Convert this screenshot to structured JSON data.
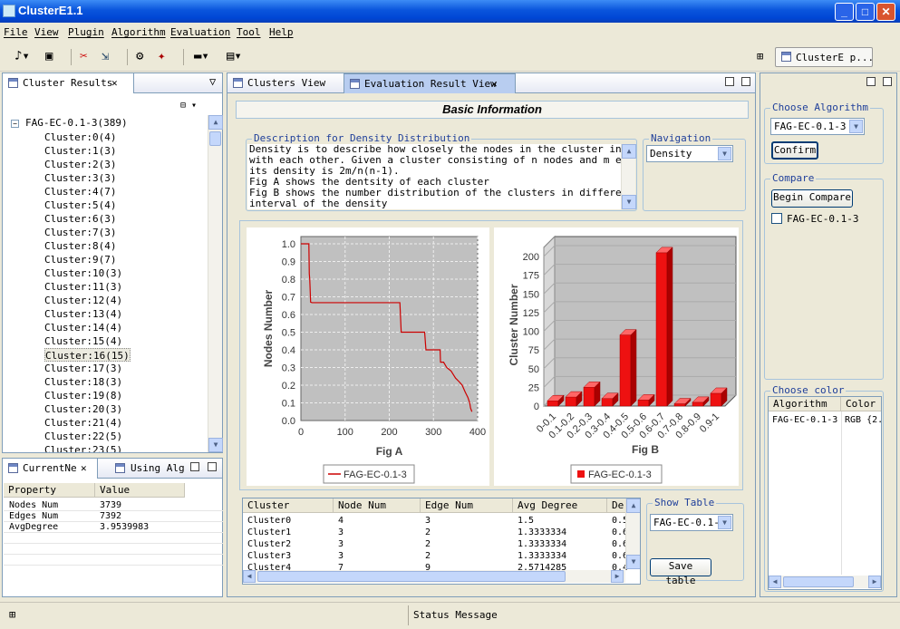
{
  "window": {
    "title": "ClusterE1.1",
    "min": "_",
    "max": "□",
    "close": "✕"
  },
  "menu": [
    "File",
    "View",
    "Plugin",
    "Algorithm",
    "Evaluation",
    "Tool",
    "Help"
  ],
  "toolbar": {
    "perspective_label": "ClusterE p..."
  },
  "cluster_results": {
    "tab_label": "Cluster Results",
    "root": "FAG-EC-0.1-3(389)",
    "items": [
      "Cluster:0(4)",
      "Cluster:1(3)",
      "Cluster:2(3)",
      "Cluster:3(3)",
      "Cluster:4(7)",
      "Cluster:5(4)",
      "Cluster:6(3)",
      "Cluster:7(3)",
      "Cluster:8(4)",
      "Cluster:9(7)",
      "Cluster:10(3)",
      "Cluster:11(3)",
      "Cluster:12(4)",
      "Cluster:13(4)",
      "Cluster:14(4)",
      "Cluster:15(4)",
      "Cluster:16(15)",
      "Cluster:17(3)",
      "Cluster:18(3)",
      "Cluster:19(8)",
      "Cluster:20(3)",
      "Cluster:21(4)",
      "Cluster:22(5)",
      "Cluster:23(5)"
    ],
    "selected_index": 16
  },
  "current_panel": {
    "tab1": "CurrentNe",
    "tab2": "Using Alg",
    "headers": [
      "Property",
      "Value"
    ],
    "rows": [
      [
        "Nodes Num",
        "3739"
      ],
      [
        "Edges Num",
        "7392"
      ],
      [
        "AvgDegree",
        "3.9539983"
      ]
    ]
  },
  "center_tabs": {
    "tab1": "Clusters View",
    "tab2": "Evaluation Result View"
  },
  "basic_info": {
    "title": "Basic Information"
  },
  "description": {
    "legend": "Description for Density Distribution",
    "lines": [
      "Density is to describe how closely the nodes in the cluster interact",
      "with each other. Given a cluster consisting of n nodes and m edges,",
      "its density is 2m/n(n-1).",
      "Fig A shows the dentsity of each cluster",
      "Fig B shows the number distribution of the clusters in different",
      "interval of the density"
    ]
  },
  "navigation": {
    "legend": "Navigation",
    "value": "Density"
  },
  "chart_data": [
    {
      "type": "line",
      "xlabel": "Fig A",
      "ylabel": "Nodes Number",
      "xlim": [
        0,
        400
      ],
      "ylim": [
        0,
        1.0
      ],
      "xticks": [
        "0",
        "100",
        "200",
        "300",
        "400"
      ],
      "yticks": [
        "0.0",
        "0.1",
        "0.2",
        "0.3",
        "0.4",
        "0.5",
        "0.6",
        "0.7",
        "0.8",
        "0.9",
        "1.0"
      ],
      "series": [
        {
          "name": "FAG-EC-0.1-3",
          "color": "#cc0000",
          "x": [
            0,
            18,
            19,
            20,
            22,
            25,
            40,
            100,
            150,
            200,
            224,
            227,
            260,
            262,
            280,
            283,
            305,
            315,
            316,
            323,
            330,
            340,
            345,
            350,
            358,
            365,
            372,
            378,
            382,
            384,
            387
          ],
          "y": [
            1.0,
            1.0,
            0.83,
            0.8,
            0.67,
            0.667,
            0.667,
            0.667,
            0.667,
            0.667,
            0.667,
            0.5,
            0.5,
            0.5,
            0.5,
            0.4,
            0.4,
            0.4,
            0.33,
            0.33,
            0.3,
            0.28,
            0.26,
            0.24,
            0.22,
            0.2,
            0.16,
            0.13,
            0.1,
            0.07,
            0.05
          ]
        }
      ],
      "grid": true,
      "legend": "bottom"
    },
    {
      "type": "bar",
      "xlabel": "Fig B",
      "ylabel": "Cluster Number",
      "ylim": [
        0,
        200
      ],
      "yticks": [
        "0",
        "25",
        "50",
        "75",
        "100",
        "125",
        "150",
        "175",
        "200"
      ],
      "categories": [
        "0-0.1",
        "0.1-0.2",
        "0.2-0.3",
        "0.3-0.4",
        "0.4-0.5",
        "0.5-0.6",
        "0.6-0.7",
        "0.7-0.8",
        "0.8-0.9",
        "0.9-1"
      ],
      "series": [
        {
          "name": "FAG-EC-0.1-3",
          "color": "#ee1111",
          "values": [
            7,
            12,
            25,
            10,
            95,
            8,
            205,
            3,
            5,
            17
          ]
        }
      ],
      "legend": "bottom",
      "style": "3d"
    }
  ],
  "result_table": {
    "headers": [
      "Cluster",
      "Node Num",
      "Edge Num",
      "Avg Degree",
      "De"
    ],
    "rows": [
      [
        "Cluster0",
        "4",
        "3",
        "1.5",
        "0.5"
      ],
      [
        "Cluster1",
        "3",
        "2",
        "1.3333334",
        "0.6"
      ],
      [
        "Cluster2",
        "3",
        "2",
        "1.3333334",
        "0.6"
      ],
      [
        "Cluster3",
        "3",
        "2",
        "1.3333334",
        "0.6"
      ],
      [
        "Cluster4",
        "7",
        "9",
        "2.5714285",
        "0.4"
      ]
    ]
  },
  "show_table": {
    "legend": "Show Table",
    "value": "FAG-EC-0.1-3",
    "save_label": "Save table"
  },
  "choose_algorithm": {
    "legend": "Choose Algorithm",
    "value": "FAG-EC-0.1-3",
    "confirm_label": "Confirm"
  },
  "compare": {
    "legend": "Compare",
    "button_label": "Begin Compare",
    "item": "FAG-EC-0.1-3"
  },
  "choose_color": {
    "legend": "Choose color",
    "headers": [
      "Algorithm",
      "Color"
    ],
    "rows": [
      [
        "FAG-EC-0.1-3",
        "RGB {2."
      ]
    ]
  },
  "status": {
    "message": "Status Message"
  }
}
